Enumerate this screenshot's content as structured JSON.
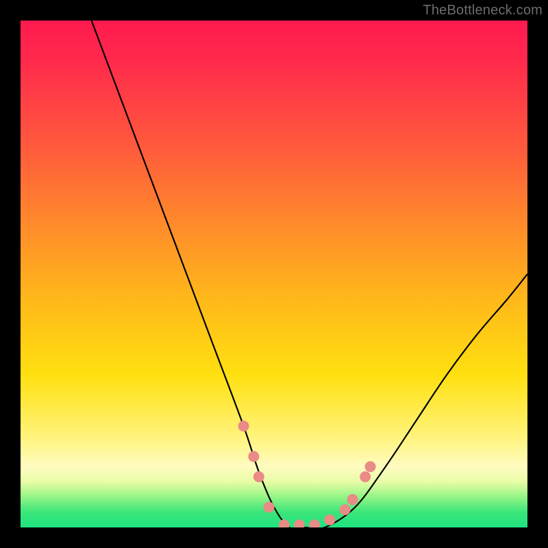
{
  "watermark": "TheBottleneck.com",
  "chart_data": {
    "type": "line",
    "title": "",
    "xlabel": "",
    "ylabel": "",
    "xlim": [
      0,
      100
    ],
    "ylim": [
      0,
      100
    ],
    "series": [
      {
        "name": "bottleneck-curve",
        "x": [
          14,
          20,
          26,
          32,
          38,
          44,
          47,
          50,
          53,
          56,
          60,
          66,
          72,
          78,
          84,
          90,
          96,
          100
        ],
        "y": [
          100,
          84,
          68,
          52,
          36,
          20,
          11,
          4,
          0,
          0,
          0,
          4,
          12,
          21,
          30,
          38,
          45,
          50
        ]
      }
    ],
    "markers": {
      "name": "highlight-dots",
      "color": "#e98b86",
      "points": [
        {
          "x": 44,
          "y": 20
        },
        {
          "x": 46,
          "y": 14
        },
        {
          "x": 47,
          "y": 10
        },
        {
          "x": 49,
          "y": 4
        },
        {
          "x": 52,
          "y": 0.5
        },
        {
          "x": 55,
          "y": 0.5
        },
        {
          "x": 58,
          "y": 0.5
        },
        {
          "x": 61,
          "y": 1.5
        },
        {
          "x": 64,
          "y": 3.5
        },
        {
          "x": 65.5,
          "y": 5.5
        },
        {
          "x": 68,
          "y": 10
        },
        {
          "x": 69,
          "y": 12
        }
      ]
    },
    "colors": {
      "curve": "#000000",
      "marker": "#e98b86",
      "gradient_top": "#ff1a4f",
      "gradient_bottom": "#1fe47f"
    }
  }
}
